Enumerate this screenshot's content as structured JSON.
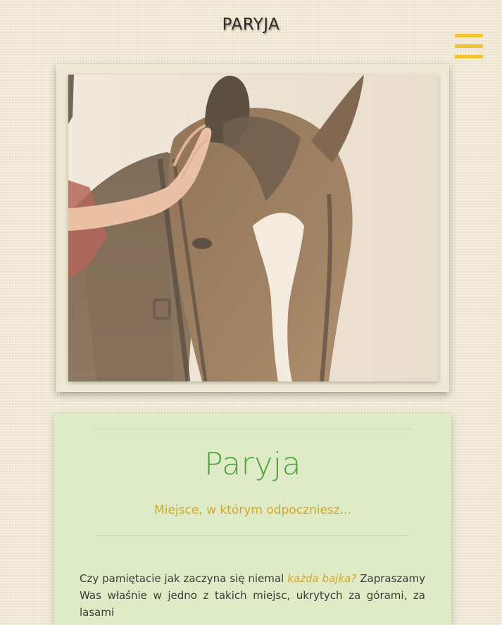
{
  "header": {
    "site_title": "PARYJA",
    "menu_icon": "hamburger-menu-icon",
    "menu_color": "#f2c230"
  },
  "hero": {
    "image_subject": "horse-head-photo"
  },
  "intro": {
    "title": "Paryja",
    "subtitle": "Miejsce, w którym odpoczniesz...",
    "paragraph_start": "Czy pamiętacie jak zaczyna się niemal ",
    "paragraph_highlight": "każda bajka?",
    "paragraph_rest": " Zapraszamy Was właśnie w jedno z takich miejsc, ukrytych za górami, za lasami"
  },
  "colors": {
    "background": "#f1ead7",
    "card_background": "#dfebc7",
    "title_green": "#4ea23a",
    "accent_yellow": "#d3a628"
  }
}
